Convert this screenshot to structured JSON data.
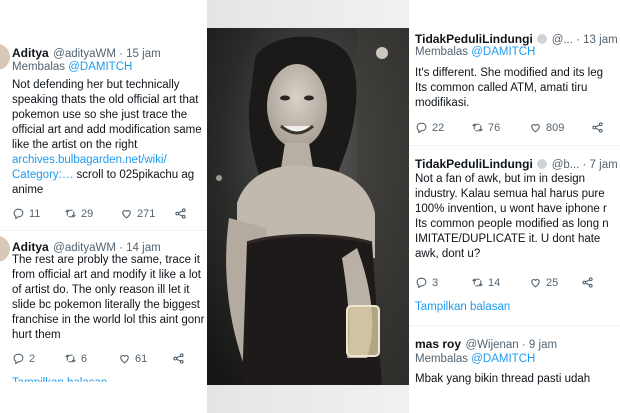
{
  "left": {
    "tweet1": {
      "name": "Aditya",
      "meta": "@adityaWM · 15 jam",
      "reply_prefix": "Membalas ",
      "reply_to": "@DAMITCH",
      "body": "Not defending her but technically\nspeaking thats the old official art that\npokemon use so she just trace the\nofficial art and add modification same\nlike the artist on the right",
      "link1": "archives.bulbagarden.net/wiki/",
      "link2": "Category:…",
      "after_link": " scroll to 025pikachu ag",
      "tail": "anime",
      "replies": "11",
      "retweets": "29",
      "likes": "271"
    },
    "tweet2": {
      "name": "Aditya",
      "meta": "@adityaWM · 14 jam",
      "body": "The rest are probly the same, trace it\nfrom official art and modify it like a lot\nof artist do. The only reason ill let it\nslide bc pokemon literally the biggest\nfranchise in the world lol this aint gonr\nhurt them",
      "replies": "2",
      "retweets": "6",
      "likes": "61"
    }
  },
  "right": {
    "tweet1": {
      "name": "TidakPeduliLindungi",
      "meta": "@... · 13 jam",
      "reply_prefix": "Membalas ",
      "reply_to": "@DAMITCH",
      "body": "It's different. She modified and its leg\nIts common called ATM, amati tiru\nmodifikasi.",
      "replies": "22",
      "retweets": "76",
      "likes": "809"
    },
    "tweet2": {
      "name": "TidakPeduliLindungi",
      "meta": "@b... · 7 jam",
      "body": "Not a fan of awk, but im in design\nindustry. Kalau semua hal harus pure\n100% invention, u wont have iphone r\nIts common people modified as long n\nIMITATE/DUPLICATE it. U dont hate\nawk, dont u?",
      "replies": "3",
      "retweets": "14",
      "likes": "25"
    },
    "show_replies": "Tampilkan balasan",
    "tweet3": {
      "name": "mas roy",
      "meta": "@Wijenan · 9 jam",
      "reply_prefix": "Membalas ",
      "reply_to": "@DAMITCH",
      "body": "Mbak yang bikin thread pasti udah"
    }
  },
  "left_bottom_text": "Tampilkan balasan"
}
